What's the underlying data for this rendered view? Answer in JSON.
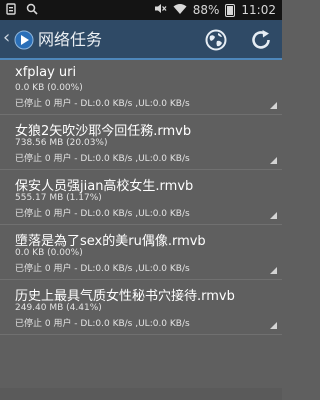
{
  "status_bar": {
    "battery_percent": "88%",
    "time": "11:02"
  },
  "action_bar": {
    "title": "网络任务",
    "accent_color": "#2f4a66"
  },
  "tasks": [
    {
      "name": "xfplay uri",
      "size": "0.0 KB  (0.00%)",
      "status": "已停止  0 用户 - DL:0.0 KB/s ,UL:0.0 KB/s"
    },
    {
      "name": "女狼2矢吹沙耶今回任務.rmvb",
      "size": "738.56 MB  (20.03%)",
      "status": "已停止  0 用户 - DL:0.0 KB/s ,UL:0.0 KB/s"
    },
    {
      "name": "保安人员强jian高校女生.rmvb",
      "size": "555.17 MB  (1.17%)",
      "status": "已停止  0 用户 - DL:0.0 KB/s ,UL:0.0 KB/s"
    },
    {
      "name": "墮落是為了sex的美ru偶像.rmvb",
      "size": "0.0 KB  (0.00%)",
      "status": "已停止  0 用户 - DL:0.0 KB/s ,UL:0.0 KB/s"
    },
    {
      "name": "历史上最具气质女性秘书穴接待.rmvb",
      "size": "249.40 MB  (4.41%)",
      "status": "已停止  0 用户 - DL:0.0 KB/s ,UL:0.0 KB/s"
    }
  ]
}
